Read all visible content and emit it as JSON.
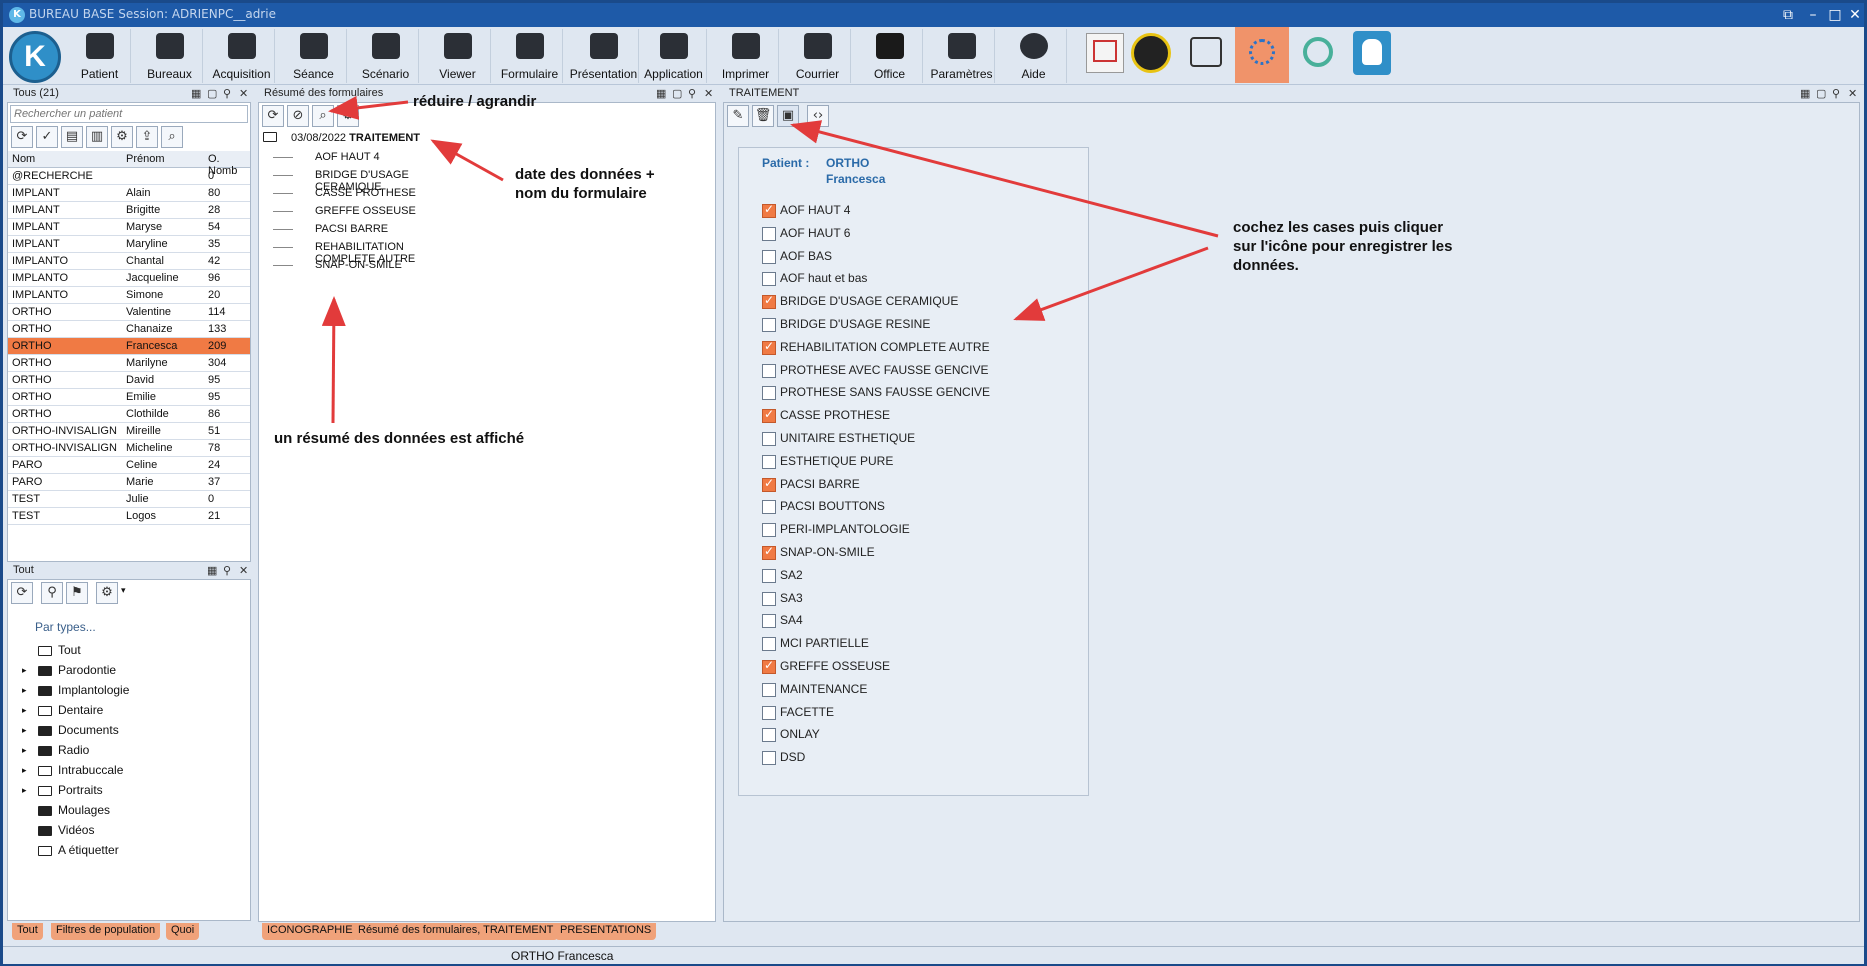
{
  "app": {
    "title": "BUREAU BASE Session: ADRIENPC__adrie",
    "logo_letter": "K"
  },
  "toolbar": {
    "buttons": [
      "Patient",
      "Bureaux",
      "Acquisition",
      "Séance",
      "Scénario",
      "Viewer",
      "Formulaire",
      "Présentation",
      "Application",
      "Imprimer",
      "Courrier",
      "Office",
      "Paramètres",
      "Aide"
    ]
  },
  "left_panel": {
    "title": "Tous (21)",
    "search_placeholder": "Rechercher un patient",
    "columns": [
      "Nom",
      "Prénom",
      "O. Nomb"
    ],
    "rows": [
      [
        "@RECHERCHE",
        "",
        "0"
      ],
      [
        "IMPLANT",
        "Alain",
        "80"
      ],
      [
        "IMPLANT",
        "Brigitte",
        "28"
      ],
      [
        "IMPLANT",
        "Maryse",
        "54"
      ],
      [
        "IMPLANT",
        "Maryline",
        "35"
      ],
      [
        "IMPLANTO",
        "Chantal",
        "42"
      ],
      [
        "IMPLANTO",
        "Jacqueline",
        "96"
      ],
      [
        "IMPLANTO",
        "Simone",
        "20"
      ],
      [
        "ORTHO",
        "Valentine",
        "114"
      ],
      [
        "ORTHO",
        "Chanaize",
        "133"
      ],
      [
        "ORTHO",
        "Francesca",
        "209"
      ],
      [
        "ORTHO",
        "Marilyne",
        "304"
      ],
      [
        "ORTHO",
        "David",
        "95"
      ],
      [
        "ORTHO",
        "Emilie",
        "95"
      ],
      [
        "ORTHO",
        "Clothilde",
        "86"
      ],
      [
        "ORTHO-INVISALIGN",
        "Mireille",
        "51"
      ],
      [
        "ORTHO-INVISALIGN",
        "Micheline",
        "78"
      ],
      [
        "PARO",
        "Celine",
        "24"
      ],
      [
        "PARO",
        "Marie",
        "37"
      ],
      [
        "TEST",
        "Julie",
        "0"
      ],
      [
        "TEST",
        "Logos",
        "21"
      ]
    ],
    "selected_index": 10
  },
  "types_panel": {
    "title": "Tout",
    "filter_label": "Par types...",
    "items": [
      "Tout",
      "Parodontie",
      "Implantologie",
      "Dentaire",
      "Documents",
      "Radio",
      "Intrabuccale",
      "Portraits",
      "Moulages",
      "Vidéos",
      "A étiquetter"
    ]
  },
  "left_tabs": [
    "Tout",
    "Filtres de population",
    "Quoi"
  ],
  "middle_panel": {
    "title": "Résumé des formulaires",
    "root_date": "03/08/2022",
    "root_name": "TRAITEMENT",
    "children": [
      "AOF HAUT 4",
      "BRIDGE D'USAGE CERAMIQUE",
      "CASSE PROTHESE",
      "GREFFE OSSEUSE",
      "PACSI BARRE",
      "REHABILITATION COMPLETE AUTRE",
      "SNAP-ON-SMILE"
    ]
  },
  "middle_tabs": [
    "ICONOGRAPHIE",
    "Résumé des formulaires, TRAITEMENT",
    "PRESENTATIONS"
  ],
  "right_panel": {
    "title": "TRAITEMENT",
    "patient_label": "Patient :",
    "patient_last": "ORTHO",
    "patient_first": "Francesca",
    "checkboxes": [
      {
        "label": "AOF HAUT 4",
        "checked": true
      },
      {
        "label": "AOF HAUT 6",
        "checked": false
      },
      {
        "label": "AOF BAS",
        "checked": false
      },
      {
        "label": "AOF haut et bas",
        "checked": false
      },
      {
        "label": "BRIDGE D'USAGE CERAMIQUE",
        "checked": true
      },
      {
        "label": "BRIDGE D'USAGE RESINE",
        "checked": false
      },
      {
        "label": "REHABILITATION COMPLETE AUTRE",
        "checked": true
      },
      {
        "label": "PROTHESE AVEC FAUSSE GENCIVE",
        "checked": false
      },
      {
        "label": "PROTHESE SANS FAUSSE GENCIVE",
        "checked": false
      },
      {
        "label": "CASSE PROTHESE",
        "checked": true
      },
      {
        "label": "UNITAIRE ESTHETIQUE",
        "checked": false
      },
      {
        "label": "ESTHETIQUE PURE",
        "checked": false
      },
      {
        "label": "PACSI BARRE",
        "checked": true
      },
      {
        "label": "PACSI BOUTTONS",
        "checked": false
      },
      {
        "label": "PERI-IMPLANTOLOGIE",
        "checked": false
      },
      {
        "label": "SNAP-ON-SMILE",
        "checked": true
      },
      {
        "label": "SA2",
        "checked": false
      },
      {
        "label": "SA3",
        "checked": false
      },
      {
        "label": "SA4",
        "checked": false
      },
      {
        "label": "MCI PARTIELLE",
        "checked": false
      },
      {
        "label": "GREFFE OSSEUSE",
        "checked": true
      },
      {
        "label": "MAINTENANCE",
        "checked": false
      },
      {
        "label": "FACETTE",
        "checked": false
      },
      {
        "label": "ONLAY",
        "checked": false
      },
      {
        "label": "DSD",
        "checked": false
      }
    ]
  },
  "annotations": {
    "reduce": "réduire / agrandir",
    "date_line1": "date des données +",
    "date_line2": "nom du formulaire",
    "summary": "un résumé des données est affiché",
    "check_line1": "cochez les cases puis cliquer",
    "check_line2": "sur l'icône pour enregistrer les",
    "check_line3": "données."
  },
  "status_bar": {
    "text": "ORTHO Francesca"
  },
  "colors": {
    "accent": "#f07a44",
    "titlebar": "#1e5aa8",
    "patient_label": "#2a6aa8",
    "annotation_arrow": "#e23b3b"
  }
}
